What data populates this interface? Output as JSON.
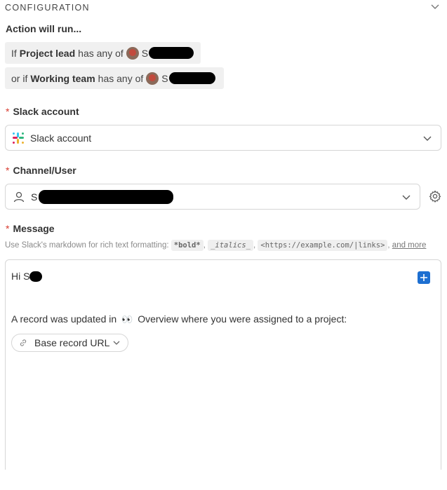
{
  "section": {
    "title": "CONFIGURATION"
  },
  "action": {
    "title": "Action will run..."
  },
  "conditions": [
    {
      "prefix": "If",
      "field": "Project lead",
      "operator": "has any of",
      "user_initial": "S"
    },
    {
      "prefix": "or if",
      "field": "Working team",
      "operator": "has any of",
      "user_initial": "S"
    }
  ],
  "slack_account": {
    "label": "Slack account",
    "value": "Slack account"
  },
  "channel": {
    "label": "Channel/User",
    "value_initial": "S"
  },
  "message": {
    "label": "Message",
    "hint_prefix": "Use Slack's markdown for rich text formatting:",
    "hint_bold": "*bold*",
    "hint_italics": "_italics_",
    "hint_link": "<https://example.com/|links>",
    "hint_more": "and more",
    "greeting": "Hi S",
    "body_before": "A record was updated in",
    "body_emoji": "👀",
    "body_after": "Overview where you were assigned to a project:",
    "chip_label": "Base record URL"
  },
  "required_mark": "*",
  "colors": {
    "accent": "#1d6fd1",
    "required": "#d83a2e"
  }
}
